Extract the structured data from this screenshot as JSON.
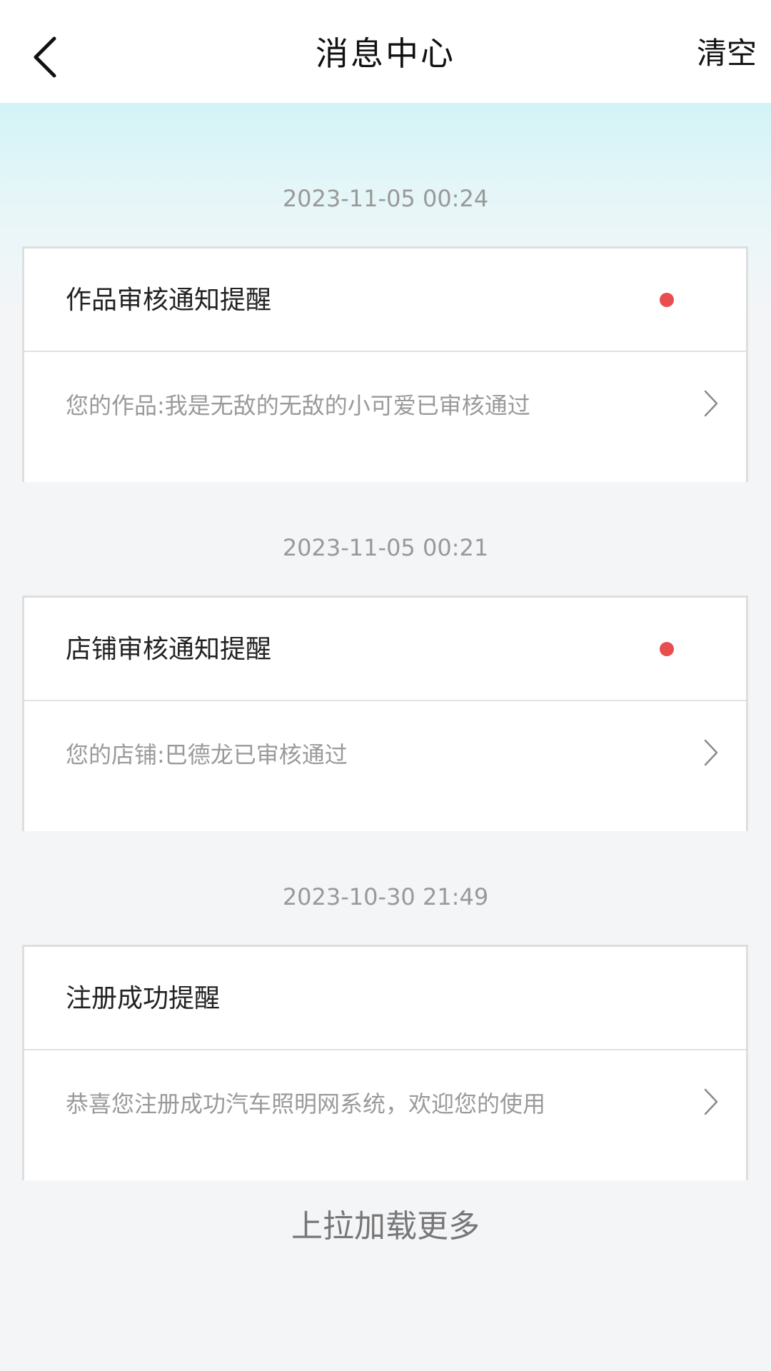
{
  "header": {
    "title": "消息中心",
    "clear_label": "清空",
    "back_icon": "back-arrow-icon"
  },
  "messages": [
    {
      "timestamp": "2023-11-05 00:24",
      "title": "作品审核通知提醒",
      "content": "您的作品:我是无敌的无敌的小可爱已审核通过",
      "unread": true
    },
    {
      "timestamp": "2023-11-05 00:21",
      "title": "店铺审核通知提醒",
      "content": "您的店铺:巴德龙已审核通过",
      "unread": true
    },
    {
      "timestamp": "2023-10-30 21:49",
      "title": "注册成功提醒",
      "content": "恭喜您注册成功汽车照明网系统，欢迎您的使用",
      "unread": false
    }
  ],
  "footer": {
    "load_more": "上拉加载更多"
  },
  "colors": {
    "unread_dot": "#e84d4f",
    "header_bg": "#ffffff",
    "page_bg": "#f4f5f7",
    "gradient_top": "#d3f3f6"
  }
}
